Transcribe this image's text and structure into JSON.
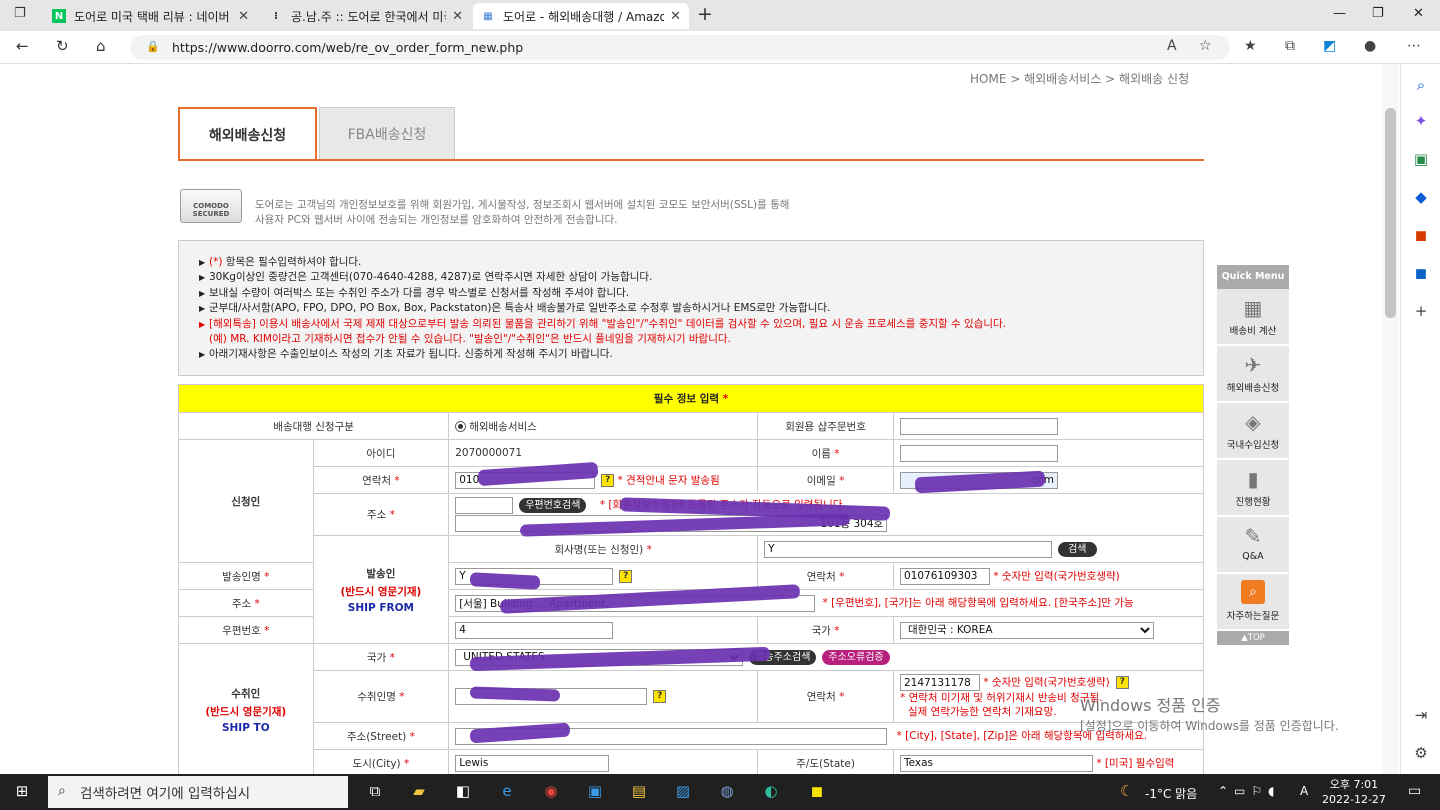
{
  "browser": {
    "tabs": [
      {
        "label": "도어로 미국 택배 리뷰 : 네이버 블",
        "icon": "N",
        "color": "#03c75a"
      },
      {
        "label": "공.남.주 :: 도어로 한국에서 미국으",
        "icon": "❢"
      },
      {
        "label": "도어로 - 해외배송대행 / Amazon",
        "icon": "▦"
      }
    ],
    "url": "https://www.doorro.com/web/re_ov_order_form_new.php"
  },
  "breadcrumb": "HOME > 해외배송서비스 > 해외배송 신청",
  "page_tabs": {
    "active": "해외배송신청",
    "inactive": "FBA배송신청"
  },
  "ssl": {
    "badge": "COMODO SECURED",
    "line1": "도어로는 고객님의 개인정보보호를 위해 회원가입, 게시물작성, 정보조회시 웹서버에 설치된 코모도 보안서버(SSL)를 통해",
    "line2": "사용자 PC와 웹서버 사이에 전송되는 개인정보를 암호화하여 안전하게 전송합니다."
  },
  "notice": {
    "l1a": "(*)",
    "l1b": " 항목은 필수입력하셔야 합니다.",
    "l2": "30Kg이상인 중량건은 고객센터(070-4640-4288, 4287)로 연락주시면 자세한 상담이 가능합니다.",
    "l3": "보내실 수량이 여러박스 또는 수취인 주소가 다를 경우 박스별로 신청서를 작성해 주셔야 합니다.",
    "l4": "군부대/사서함(APO, FPO, DPO, PO Box, Box, Packstaton)은 특송사 배송불가로 일반주소로 수정후 발송하시거나 EMS로만 가능합니다.",
    "l5": "[해외특송] 이용시 배송사에서 국제 제재 대상으로부터 발송 의뢰된 물품을 관리하기 위해 \"발송인\"/\"수취인\" 데이터를 검사할 수 있으며, 필요 시 운송 프로세스를 중지할 수 있습니다.",
    "l6": "(예) MR. KIM이라고 기재하시면 접수가 안될 수 있습니다. \"발송인\"/\"수취인\"은 반드시 풀네임을 기재하시기 바랍니다.",
    "l7": "아래기재사항은 수출인보이스 작성의 기초 자료가 됩니다. 신중하게 작성해 주시기 바랍니다."
  },
  "form": {
    "header": "필수 정보 입력",
    "star": "*",
    "delivery_type_label": "배송대행 신청구분",
    "delivery_type_value": "해외배송서비스",
    "order_no_label": "회원용 샵주문번호",
    "applicant": {
      "group": "신청인",
      "id_label": "아이디",
      "id_value": "2070000071",
      "name_label": "이름",
      "name_value": "",
      "phone_label": "연락처",
      "phone_value": "010",
      "phone_note": "* 견적안내 문자 발송됨",
      "email_label": "이메일",
      "email_value": "com",
      "addr_label": "주소",
      "zip_btn": "우편번호검색",
      "addr_note": "* [회원정보수정]에 등록된 주소가 자동으로 입력됩니다.",
      "addr_value": "101동 304호"
    },
    "sender": {
      "group": "발송인",
      "group_note": "(반드시 영문기재)",
      "group_en": "SHIP FROM",
      "company_label": "회사명(또는 신청인)",
      "company_value": "Y",
      "search_btn": "검색",
      "name_label": "발송인명",
      "name_value": "Y",
      "phone_label": "연락처",
      "phone_value": "01076109303",
      "phone_note": "* 숫자만 입력(국가번호생략)",
      "addr_label": "주소",
      "addr_value": "[서울] Building ... Apartment,",
      "addr_note": "* [우편번호], [국가]는 아래 해당항목에 입력하세요. [한국주소]만 가능",
      "zip_label": "우편번호",
      "zip_value": "4",
      "country_label": "국가",
      "country_value": "대한민국 : KOREA"
    },
    "recipient": {
      "group": "수취인",
      "group_note": "(반드시 영문기재)",
      "group_en": "SHIP TO",
      "country_label": "국가",
      "country_value": "UNITED STATES",
      "addr_search_btn": "발송주소검색",
      "addr_verify_btn": "주소오류검증",
      "name_label": "수취인명",
      "name_value": "",
      "phone_label": "연락처",
      "phone_value": "2147131178",
      "phone_note": "* 숫자만 입력(국가번호생략)",
      "phone_warn1": "* 연락처 미기재 및 허위기재시 반송비 청구됨.",
      "phone_warn2": "실제 연락가능한 연락처 기재요망.",
      "street_label": "주소(Street)",
      "street_value": "",
      "street_note": "* [City], [State], [Zip]은 아래 해당항목에 입력하세요.",
      "city_label": "도시(City)",
      "city_value": "Lewis",
      "state_label": "주/도(State)",
      "state_value": "Texas",
      "state_note": "* [미국] 필수입력"
    }
  },
  "quick_menu": {
    "title": "Quick Menu",
    "items": [
      "배송비 계산",
      "해외배송신청",
      "국내수입신청",
      "진행현황",
      "Q&A",
      "자주하는질문"
    ],
    "top": "▲TOP"
  },
  "watermark": {
    "line1": "Windows 정품 인증",
    "line2": "[설정]으로 이동하여 Windows를 정품 인증합니다."
  },
  "taskbar": {
    "search_placeholder": "검색하려면 여기에 입력하십시",
    "weather": "-1°C 맑음",
    "time": "오후 7:01",
    "date": "2022-12-27"
  }
}
